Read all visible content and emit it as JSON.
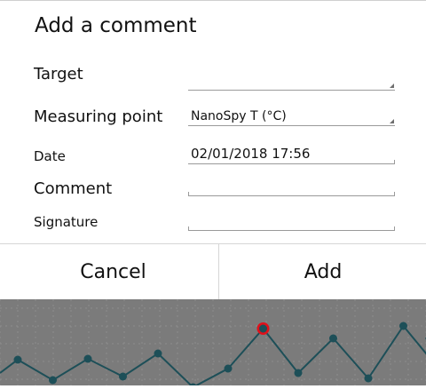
{
  "dialog": {
    "title": "Add a comment",
    "fields": {
      "target": {
        "label": "Target",
        "value": ""
      },
      "measuring_point": {
        "label": "Measuring point",
        "value": "NanoSpy T (°C)"
      },
      "date": {
        "label": "Date",
        "value": "02/01/2018 17:56"
      },
      "comment": {
        "label": "Comment",
        "value": ""
      },
      "signature": {
        "label": "Signature",
        "value": ""
      }
    },
    "buttons": {
      "cancel": "Cancel",
      "add": "Add"
    }
  },
  "background_chart": {
    "line_color": "#1d4f58",
    "background_color": "#7b7b7b",
    "highlight_color": "#e0101a",
    "highlight_index": 7,
    "points": [
      405,
      428,
      404,
      424,
      398,
      436,
      415,
      370,
      420,
      381,
      426,
      367,
      415
    ]
  }
}
